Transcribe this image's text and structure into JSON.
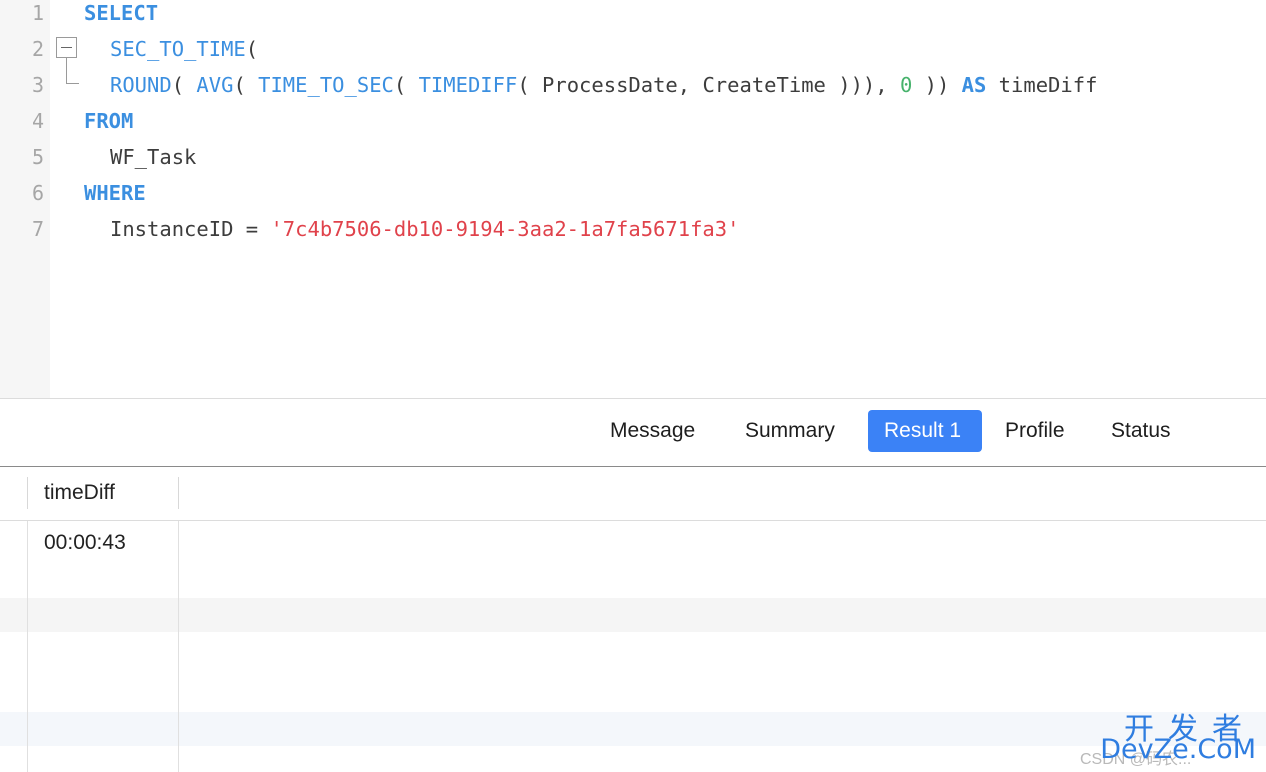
{
  "editor": {
    "lines": [
      {
        "num": "1",
        "tokens": [
          {
            "t": "SELECT",
            "c": "kw"
          }
        ]
      },
      {
        "num": "2",
        "tokens": [
          {
            "t": "SEC_TO_TIME",
            "c": "fn"
          },
          {
            "t": "(",
            "c": "pl"
          }
        ]
      },
      {
        "num": "3",
        "tokens": [
          {
            "t": "ROUND",
            "c": "fn"
          },
          {
            "t": "( ",
            "c": "pl"
          },
          {
            "t": "AVG",
            "c": "fn"
          },
          {
            "t": "( ",
            "c": "pl"
          },
          {
            "t": "TIME_TO_SEC",
            "c": "fn"
          },
          {
            "t": "( ",
            "c": "pl"
          },
          {
            "t": "TIMEDIFF",
            "c": "fn"
          },
          {
            "t": "( ProcessDate, CreateTime ))), ",
            "c": "pl"
          },
          {
            "t": "0",
            "c": "num"
          },
          {
            "t": " )) ",
            "c": "pl"
          },
          {
            "t": "AS",
            "c": "kw"
          },
          {
            "t": " timeDiff",
            "c": "pl"
          }
        ]
      },
      {
        "num": "4",
        "tokens": [
          {
            "t": "FROM",
            "c": "kw"
          }
        ]
      },
      {
        "num": "5",
        "tokens": [
          {
            "t": "WF_Task",
            "c": "pl"
          }
        ]
      },
      {
        "num": "6",
        "tokens": [
          {
            "t": "WHERE",
            "c": "kw"
          }
        ]
      },
      {
        "num": "7",
        "tokens": [
          {
            "t": "InstanceID = ",
            "c": "pl"
          },
          {
            "t": "'7c4b7506-db10-9194-3aa2-1a7fa5671fa3'",
            "c": "str"
          }
        ]
      }
    ]
  },
  "tabs": {
    "message": "Message",
    "summary": "Summary",
    "result1": "Result 1",
    "profile": "Profile",
    "status": "Status",
    "active": "Result 1"
  },
  "grid": {
    "columns": [
      "timeDiff"
    ],
    "rows": [
      [
        "00:00:43"
      ]
    ]
  },
  "watermark": {
    "cn": "开发者",
    "en": "DevZe.CoM",
    "csdn": "CSDN @码农..."
  },
  "colors": {
    "keyword": "#3b8fe0",
    "number": "#46b26b",
    "string": "#e0424b",
    "active_tab": "#3b82f6"
  }
}
